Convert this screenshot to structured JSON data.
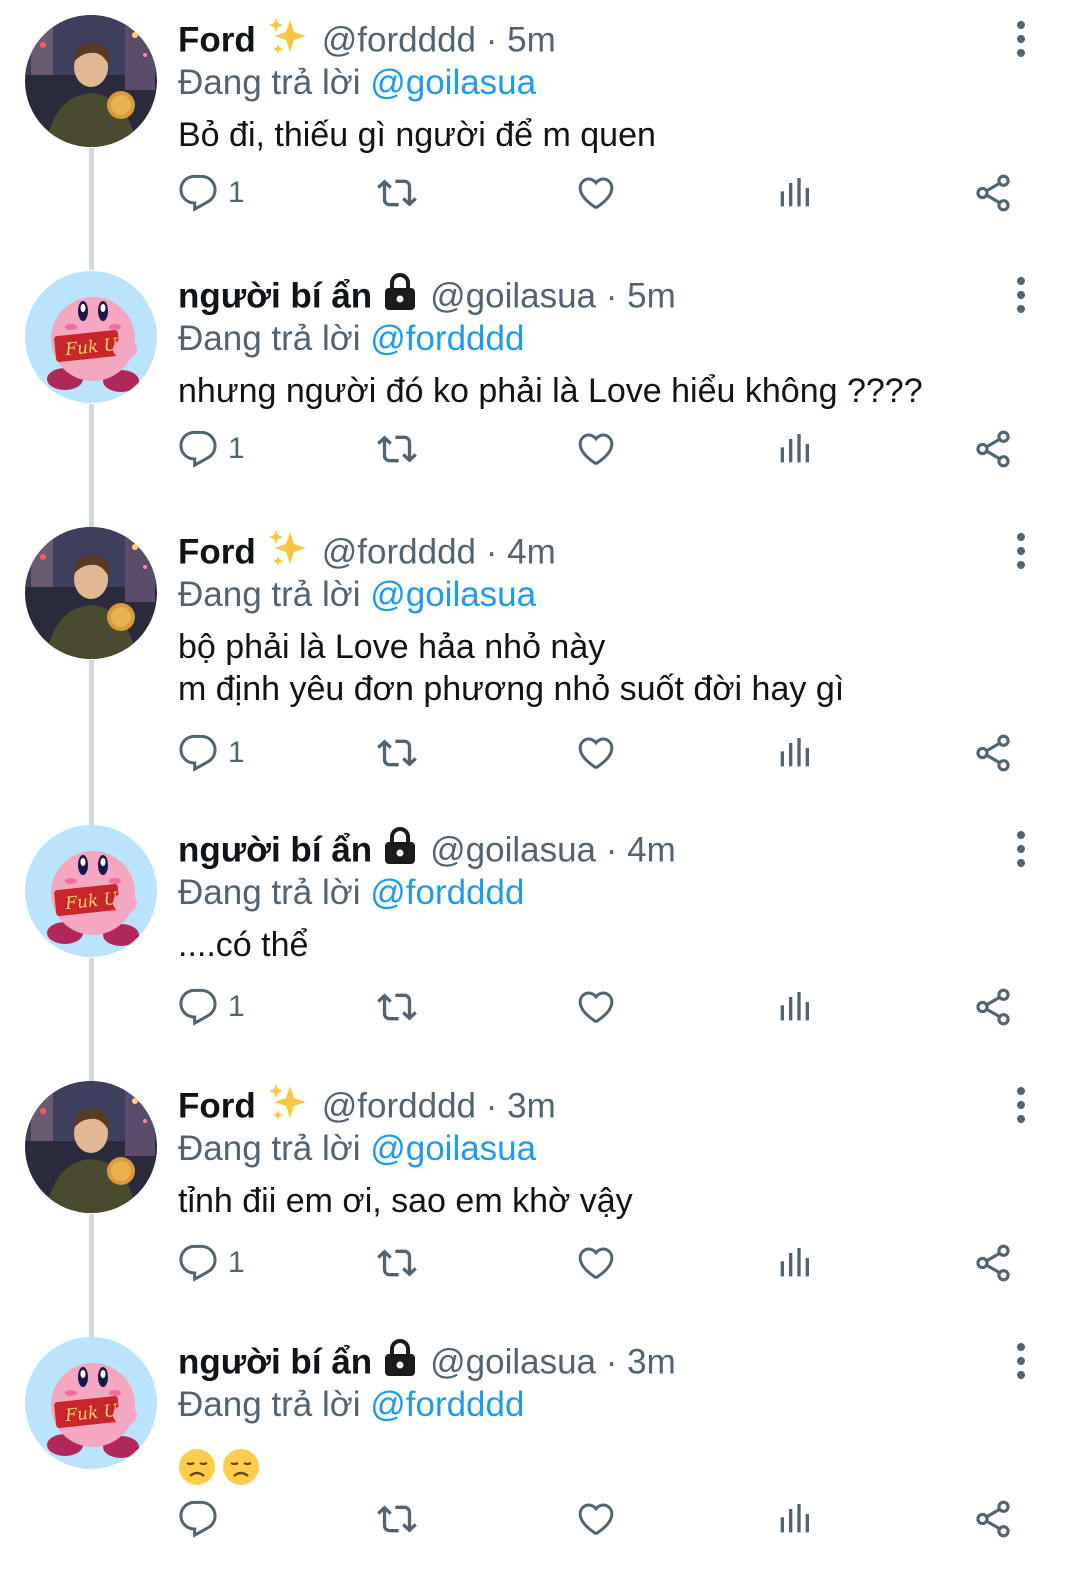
{
  "colors": {
    "text": "#0f1419",
    "secondary": "#536471",
    "accent": "#1d9bf0",
    "line": "#cfd9de"
  },
  "tweets": [
    {
      "name": "Ford",
      "name_icon": "sparkles-icon",
      "handle": "@fordddd",
      "dot": "·",
      "time": "5m",
      "reply_prefix": "Đang trả lời",
      "reply_to": "@goilasua",
      "text": "Bỏ đi, thiếu gì người để m quen",
      "reply_count": "1",
      "avatar": "photo-avatar"
    },
    {
      "name": "người bí ẩn",
      "name_icon": "lock-icon",
      "handle": "@goilasua",
      "dot": "·",
      "time": "5m",
      "reply_prefix": "Đang trả lời",
      "reply_to": "@fordddd",
      "text": "nhưng người đó ko phải là Love hiểu không ????",
      "reply_count": "1",
      "avatar": "kirby-avatar",
      "avatar_text": "Fuk U"
    },
    {
      "name": "Ford",
      "name_icon": "sparkles-icon",
      "handle": "@fordddd",
      "dot": "·",
      "time": "4m",
      "reply_prefix": "Đang trả lời",
      "reply_to": "@goilasua",
      "text": "bộ phải là Love hảa nhỏ này\nm định yêu đơn phương nhỏ suốt đời hay gì",
      "reply_count": "1",
      "avatar": "photo-avatar"
    },
    {
      "name": "người bí ẩn",
      "name_icon": "lock-icon",
      "handle": "@goilasua",
      "dot": "·",
      "time": "4m",
      "reply_prefix": "Đang trả lời",
      "reply_to": "@fordddd",
      "text": "....có thể",
      "reply_count": "1",
      "avatar": "kirby-avatar",
      "avatar_text": "Fuk U"
    },
    {
      "name": "Ford",
      "name_icon": "sparkles-icon",
      "handle": "@fordddd",
      "dot": "·",
      "time": "3m",
      "reply_prefix": "Đang trả lời",
      "reply_to": "@goilasua",
      "text": "tỉnh đii em ơi, sao em khờ vậy",
      "reply_count": "1",
      "avatar": "photo-avatar"
    },
    {
      "name": "người bí ẩn",
      "name_icon": "lock-icon",
      "handle": "@goilasua",
      "dot": "·",
      "time": "3m",
      "reply_prefix": "Đang trả lời",
      "reply_to": "@fordddd",
      "text": "",
      "emojis": [
        "disappointed-face-icon",
        "disappointed-face-icon"
      ],
      "reply_count": "",
      "avatar": "kirby-avatar",
      "avatar_text": "Fuk U"
    }
  ]
}
